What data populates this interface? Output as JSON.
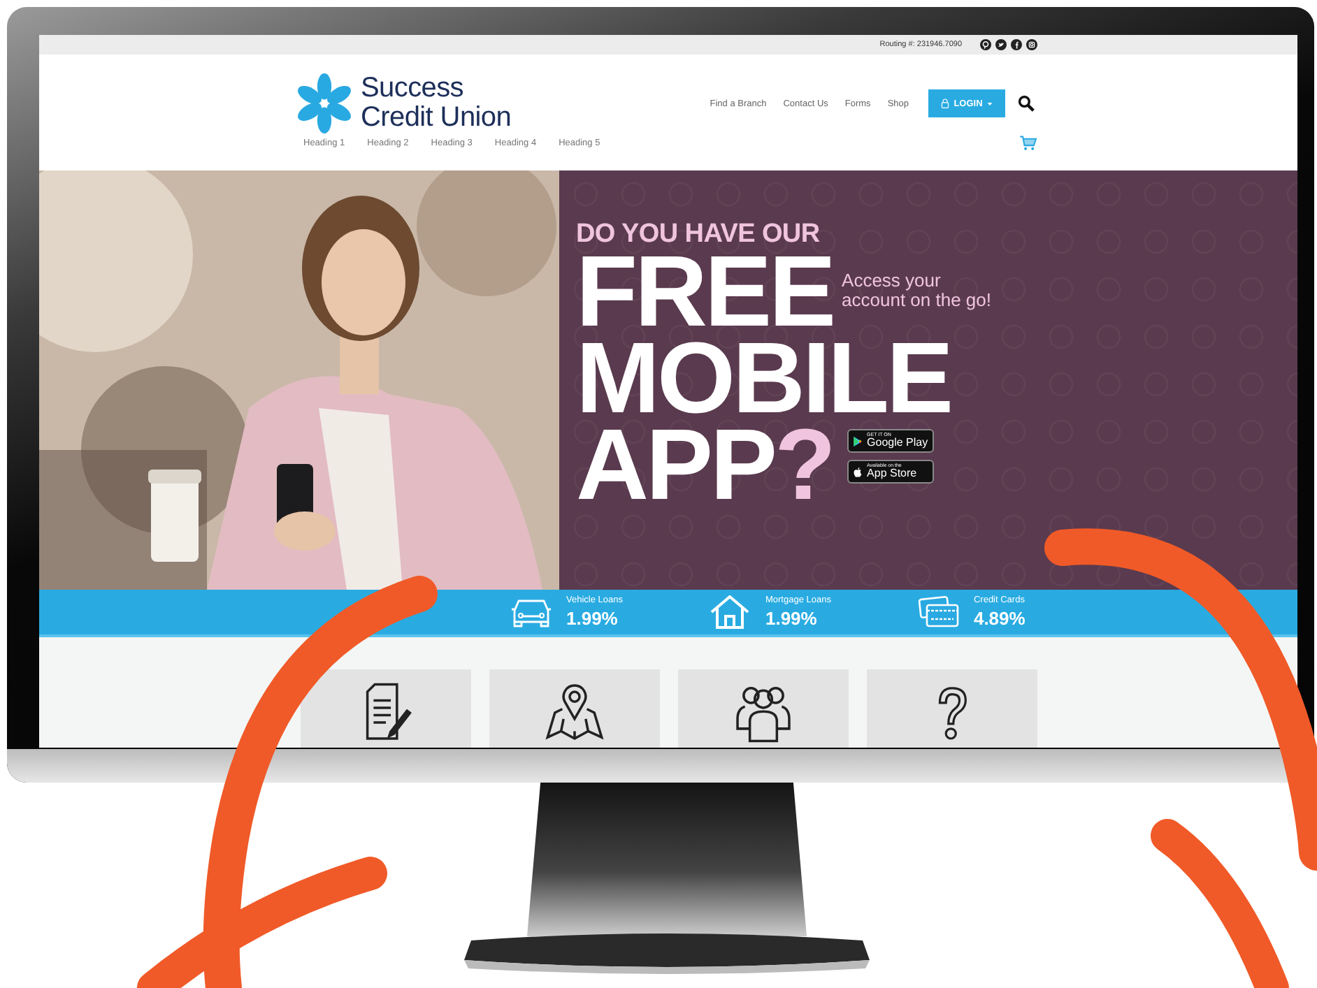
{
  "top_bar": {
    "routing": "Routing #: 231946.7090",
    "social": [
      {
        "kind": "pin"
      },
      {
        "kind": "bird"
      },
      {
        "kind": "f"
      },
      {
        "kind": "camera"
      }
    ]
  },
  "header": {
    "logo": {
      "line1": "Success",
      "line2": "Credit Union"
    },
    "nav": [
      "Find a Branch",
      "Contact Us",
      "Forms",
      "Shop"
    ],
    "login": "LOGIN",
    "headings": [
      "Heading 1",
      "Heading 2",
      "Heading 3",
      "Heading 4",
      "Heading 5"
    ]
  },
  "hero": {
    "kicker": "DO YOU HAVE OUR",
    "line1": "FREE",
    "line2": "MOBILE",
    "line3": "APP",
    "mark": "?",
    "aside": "Access your account on the go!",
    "badges": [
      {
        "kind": "play",
        "small": "GET IT ON",
        "big": "Google Play"
      },
      {
        "kind": "apple",
        "small": "Available on the",
        "big": "App Store"
      }
    ]
  },
  "rates": [
    {
      "kind": "car",
      "label": "Vehicle Loans",
      "value": "1.99%"
    },
    {
      "kind": "house",
      "label": "Mortgage Loans",
      "value": "1.99%"
    },
    {
      "kind": "card",
      "label": "Credit Cards",
      "value": "4.89%"
    }
  ],
  "tiles": [
    {
      "kind": "document"
    },
    {
      "kind": "map"
    },
    {
      "kind": "people"
    },
    {
      "kind": "question"
    }
  ]
}
